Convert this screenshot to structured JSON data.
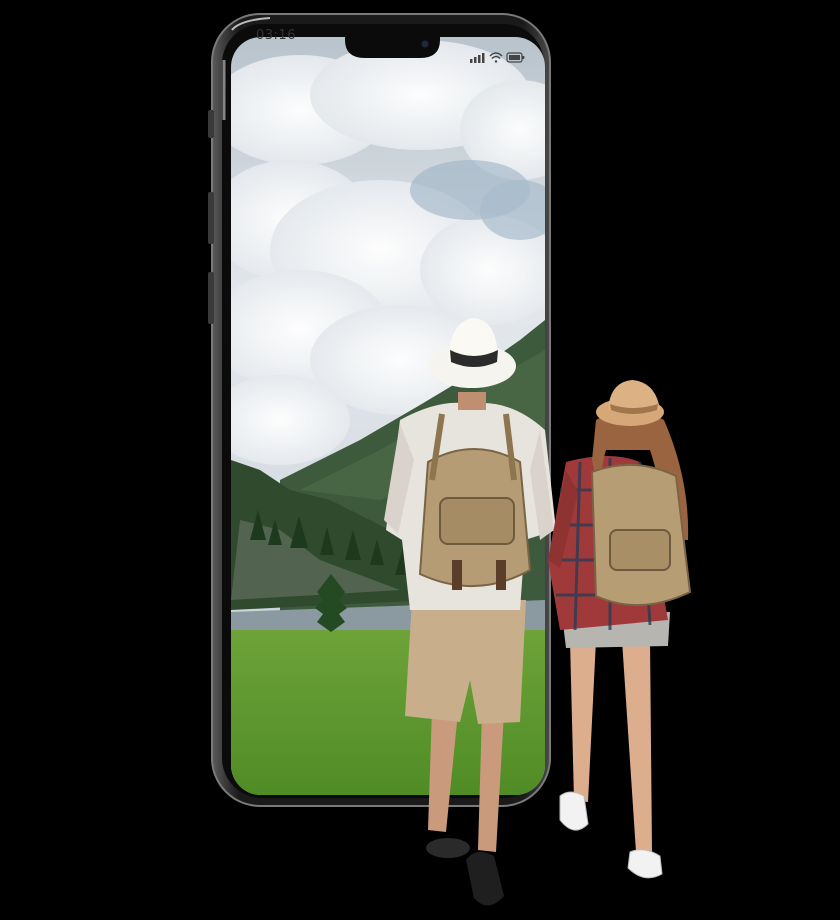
{
  "phone": {
    "status_bar": {
      "time": "03:16",
      "icons": [
        "signal-icon",
        "wifi-icon",
        "battery-icon"
      ]
    }
  },
  "colors": {
    "background": "#000000",
    "sky": "#c9d4dc",
    "grass": "#5f9a2e",
    "phone_frame": "#1c1c1c"
  }
}
